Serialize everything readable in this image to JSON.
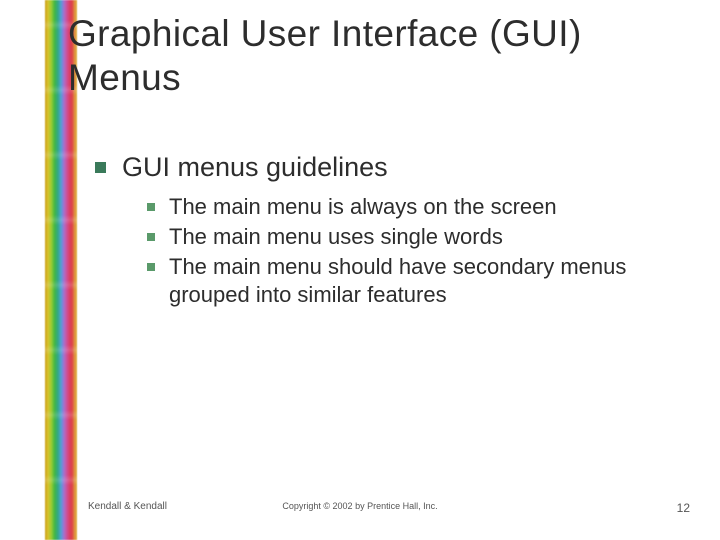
{
  "title_line1": "Graphical User Interface (GUI)",
  "title_line2": "Menus",
  "heading": "GUI menus guidelines",
  "bullets": [
    "The main menu is always on the screen",
    "The main menu uses single words",
    "The main menu should have secondary menus grouped into similar features"
  ],
  "footer": {
    "left": "Kendall & Kendall",
    "center": "Copyright © 2002 by Prentice Hall, Inc.",
    "page": "12"
  }
}
